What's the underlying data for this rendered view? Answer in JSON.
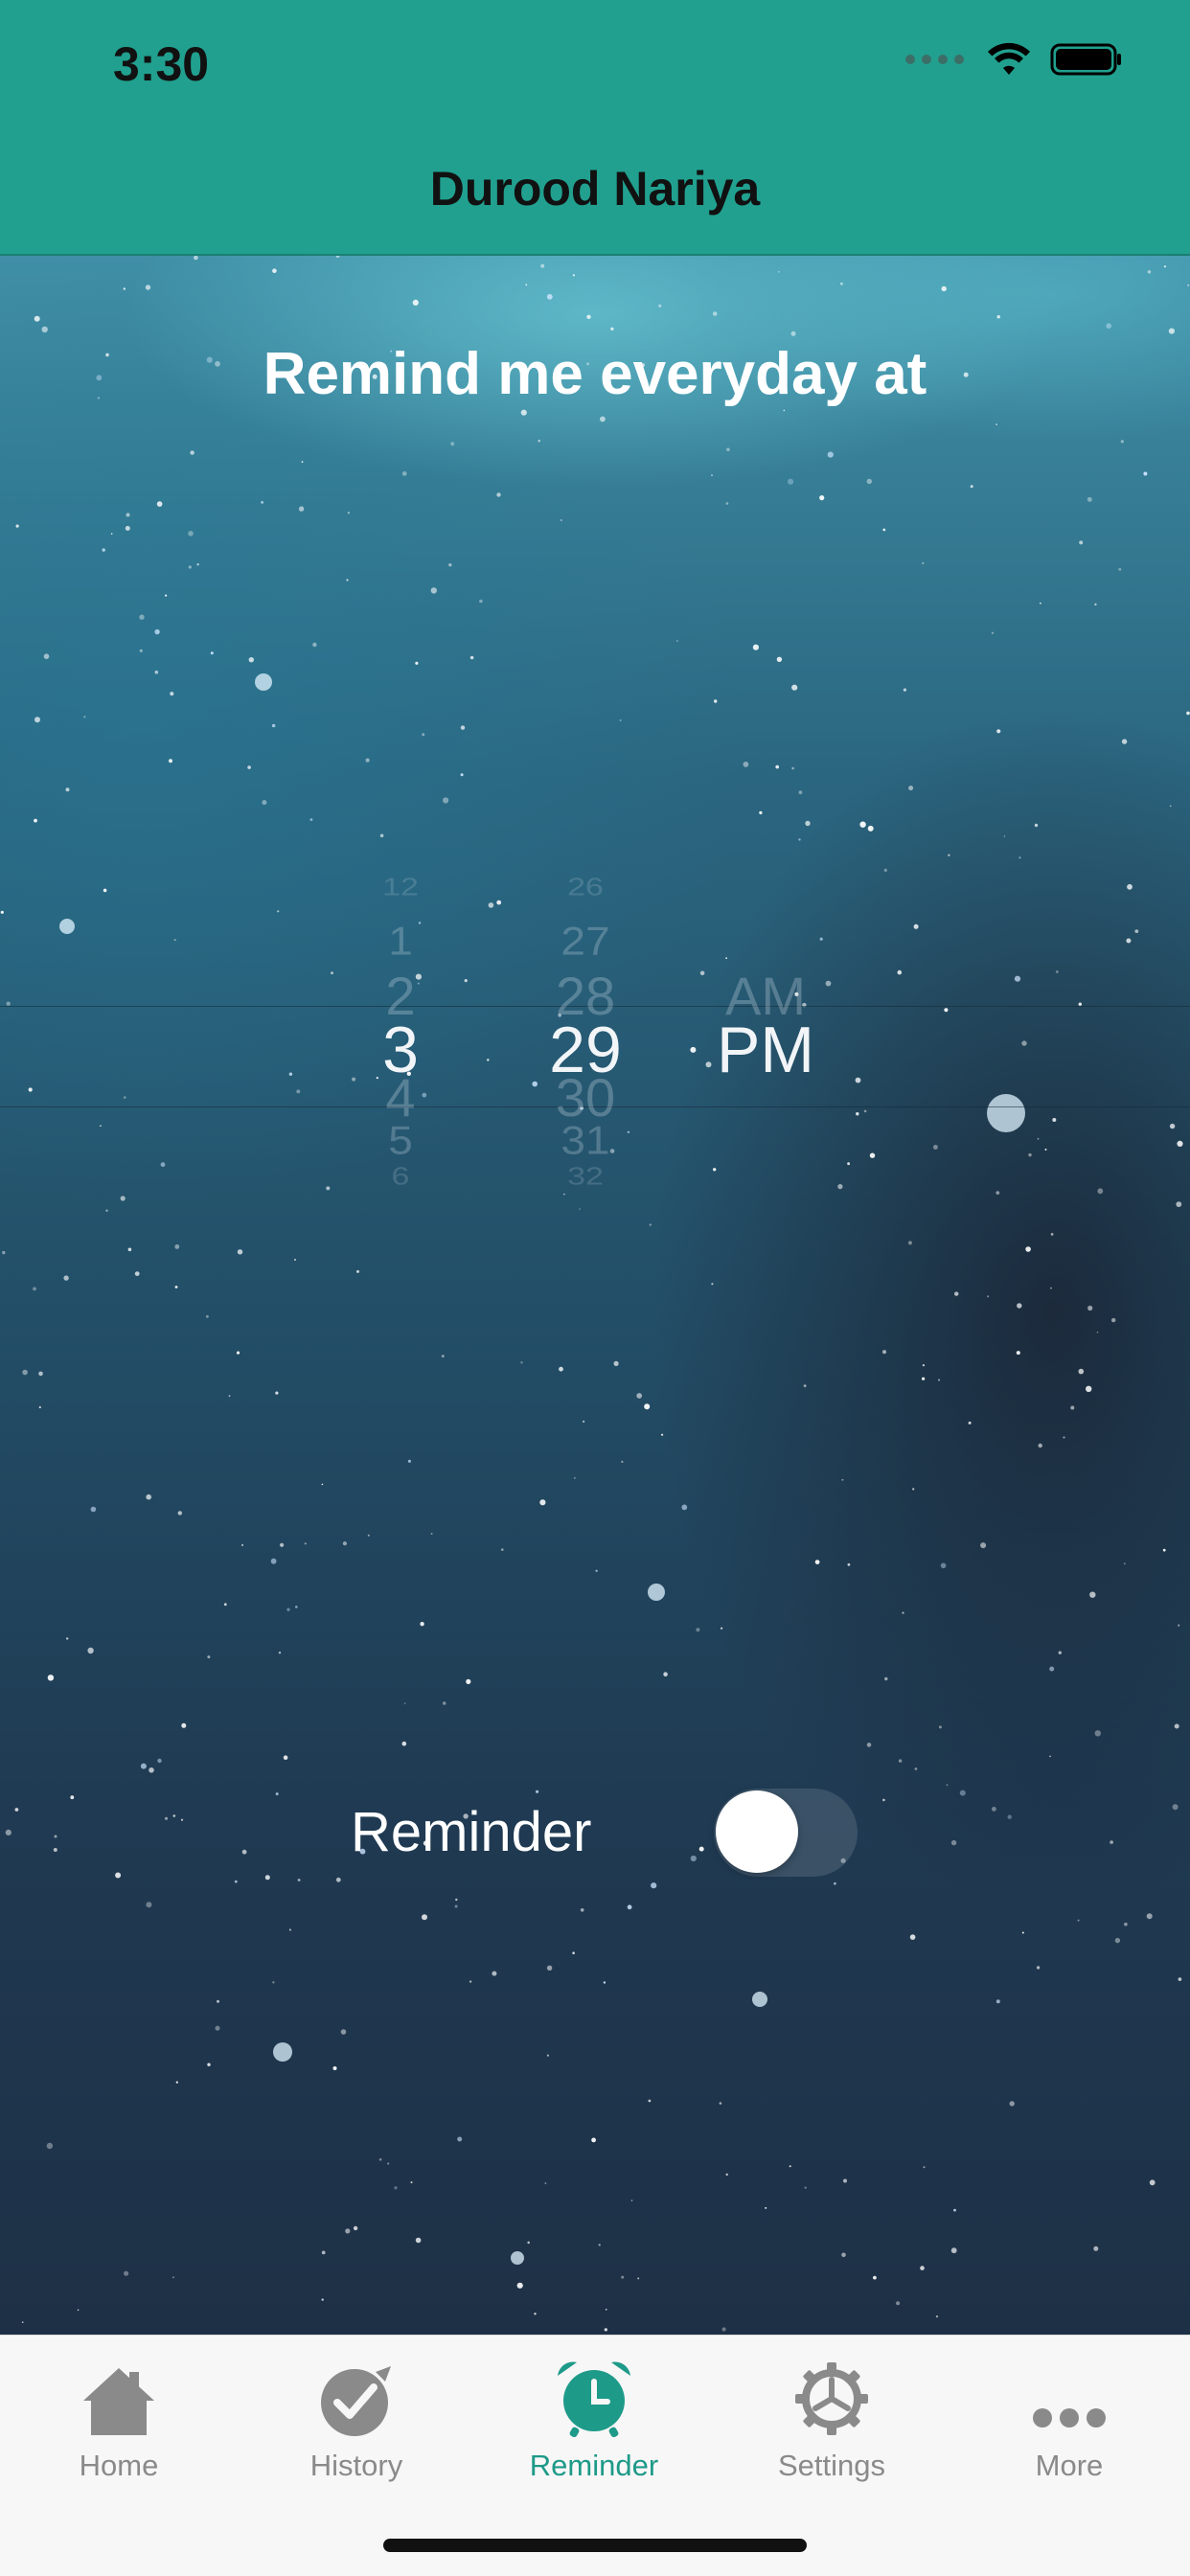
{
  "status_bar": {
    "time": "3:30"
  },
  "nav": {
    "title": "Durood Nariya"
  },
  "main": {
    "title": "Remind me everyday at",
    "picker": {
      "hours": [
        "12",
        "1",
        "2",
        "3",
        "4",
        "5",
        "6"
      ],
      "minutes": [
        "26",
        "27",
        "28",
        "29",
        "30",
        "31",
        "32"
      ],
      "periods": [
        "AM",
        "PM"
      ],
      "selected": {
        "hour": "3",
        "minute": "29",
        "period": "PM"
      }
    },
    "reminder": {
      "label": "Reminder",
      "enabled": false
    }
  },
  "tabbar": {
    "items": [
      {
        "label": "Home",
        "icon": "home-icon",
        "active": false
      },
      {
        "label": "History",
        "icon": "check-badge-icon",
        "active": false
      },
      {
        "label": "Reminder",
        "icon": "alarm-clock-icon",
        "active": true
      },
      {
        "label": "Settings",
        "icon": "gear-icon",
        "active": false
      },
      {
        "label": "More",
        "icon": "more-icon",
        "active": false
      }
    ],
    "accent_color": "#1e9a89",
    "inactive_color": "#8a8a8a"
  },
  "colors": {
    "header": "#21a08f"
  }
}
